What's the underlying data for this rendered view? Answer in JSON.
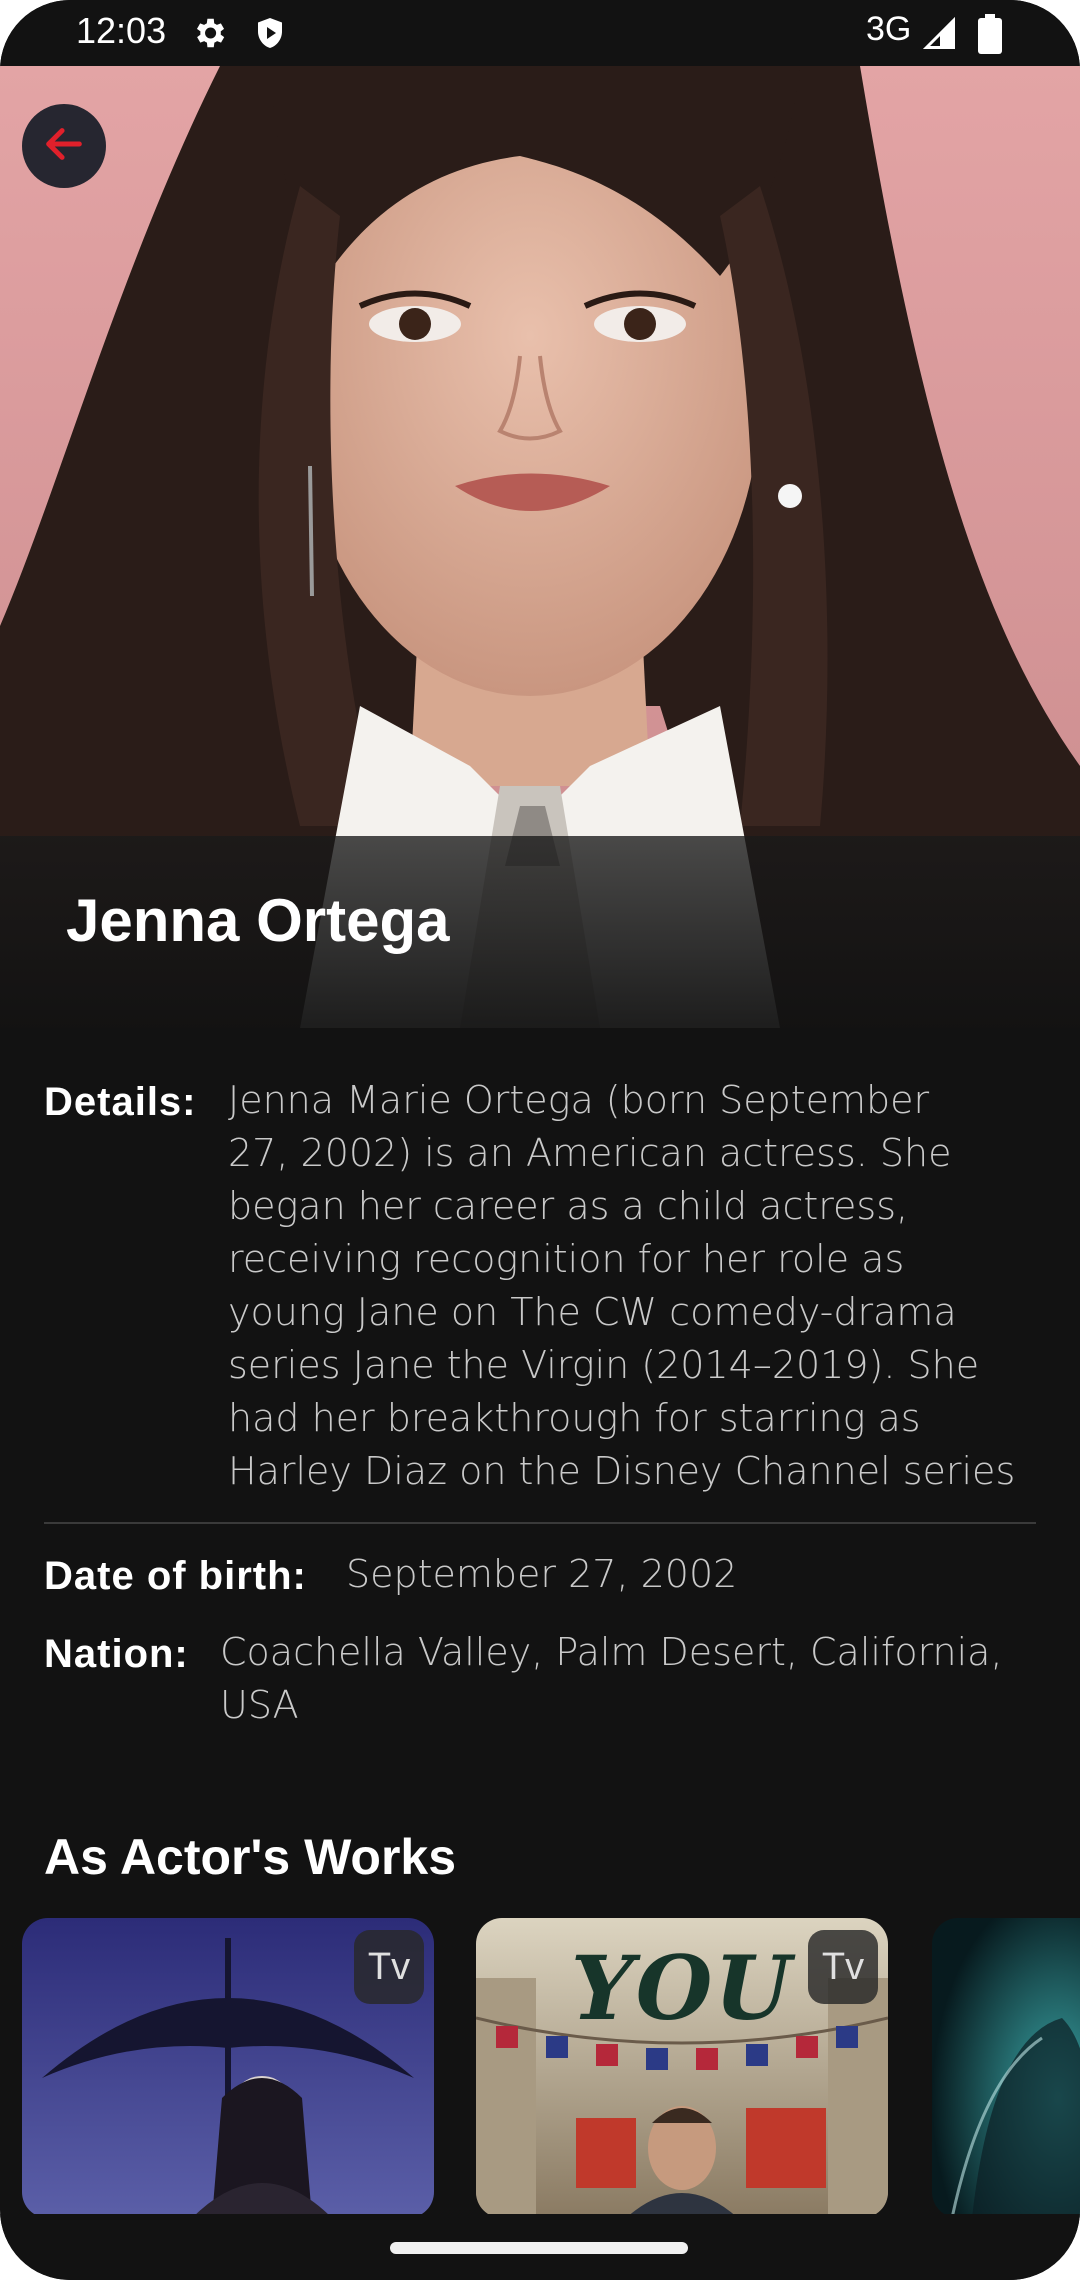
{
  "status_bar": {
    "time": "12:03",
    "network": "3G",
    "icons": [
      "gear-icon",
      "play-protect-icon",
      "signal-icon",
      "battery-icon"
    ]
  },
  "header": {
    "back_icon": "arrow-left-icon",
    "actor_name": "Jenna Ortega"
  },
  "details": {
    "label": "Details:",
    "lines": [
      "Jenna Marie Ortega (born September",
      "27, 2002) is an American actress. She",
      "began her career as a child actress,",
      "receiving recognition for her role as",
      "young Jane on The CW comedy-drama",
      "series Jane the Virgin (2014–2019). She",
      "had her breakthrough for starring as",
      "Harley Diaz on the Disney Channel series"
    ]
  },
  "birth": {
    "label": "Date of birth:",
    "value": "September 27, 2002"
  },
  "nation": {
    "label": "Nation:",
    "lines": [
      "Coachella Valley, Palm Desert, California,",
      "USA"
    ]
  },
  "works": {
    "title": "As Actor's Works",
    "items": [
      {
        "badge": "Tv"
      },
      {
        "badge": "Tv",
        "poster_text": "YOU"
      },
      {}
    ]
  },
  "colors": {
    "background": "#121212",
    "accent_red": "#e0202b",
    "label_white": "#ffffff",
    "value_gray": "#c9c9c9"
  }
}
